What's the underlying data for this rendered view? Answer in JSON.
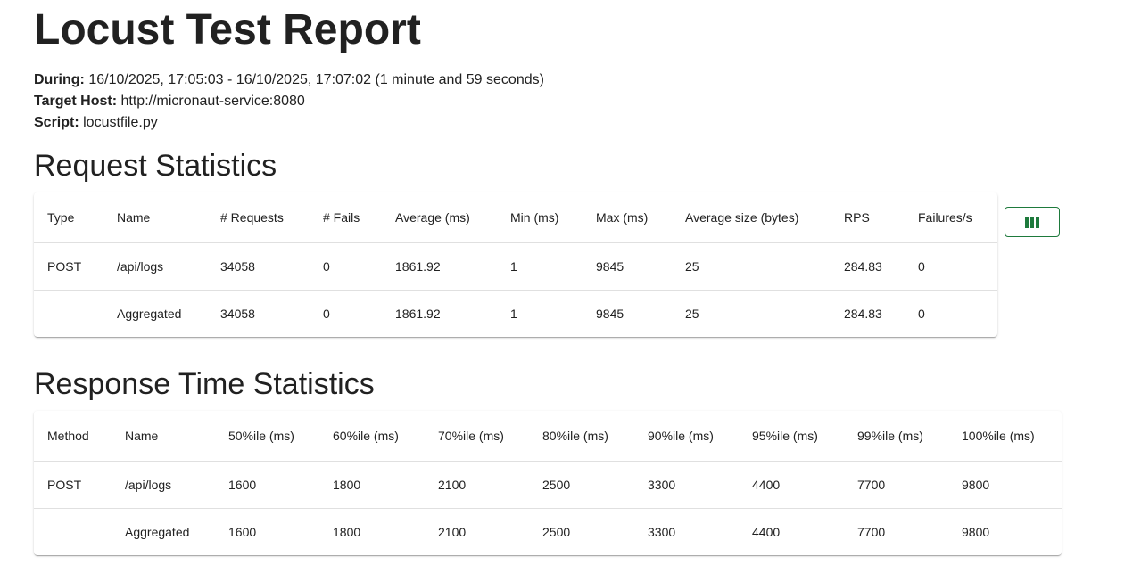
{
  "report": {
    "title": "Locust Test Report",
    "during_label": "During:",
    "during_value": "16/10/2025, 17:05:03 - 16/10/2025, 17:07:02 (1 minute and 59 seconds)",
    "host_label": "Target Host:",
    "host_value": "http://micronaut-service:8080",
    "script_label": "Script:",
    "script_value": "locustfile.py"
  },
  "request_stats": {
    "heading": "Request Statistics",
    "columns": [
      "Type",
      "Name",
      "# Requests",
      "# Fails",
      "Average (ms)",
      "Min (ms)",
      "Max (ms)",
      "Average size (bytes)",
      "RPS",
      "Failures/s"
    ],
    "rows": [
      [
        "POST",
        "/api/logs",
        "34058",
        "0",
        "1861.92",
        "1",
        "9845",
        "25",
        "284.83",
        "0"
      ],
      [
        "",
        "Aggregated",
        "34058",
        "0",
        "1861.92",
        "1",
        "9845",
        "25",
        "284.83",
        "0"
      ]
    ],
    "column_button_icon": "view-column-icon"
  },
  "response_stats": {
    "heading": "Response Time Statistics",
    "columns": [
      "Method",
      "Name",
      "50%ile (ms)",
      "60%ile (ms)",
      "70%ile (ms)",
      "80%ile (ms)",
      "90%ile (ms)",
      "95%ile (ms)",
      "99%ile (ms)",
      "100%ile (ms)"
    ],
    "rows": [
      [
        "POST",
        "/api/logs",
        "1600",
        "1800",
        "2100",
        "2500",
        "3300",
        "4400",
        "7700",
        "9800"
      ],
      [
        "",
        "Aggregated",
        "1600",
        "1800",
        "2100",
        "2500",
        "3300",
        "4400",
        "7700",
        "9800"
      ]
    ]
  },
  "colors": {
    "accent": "#1e7a3c",
    "text": "#212121",
    "divider": "#e0e0e0"
  }
}
